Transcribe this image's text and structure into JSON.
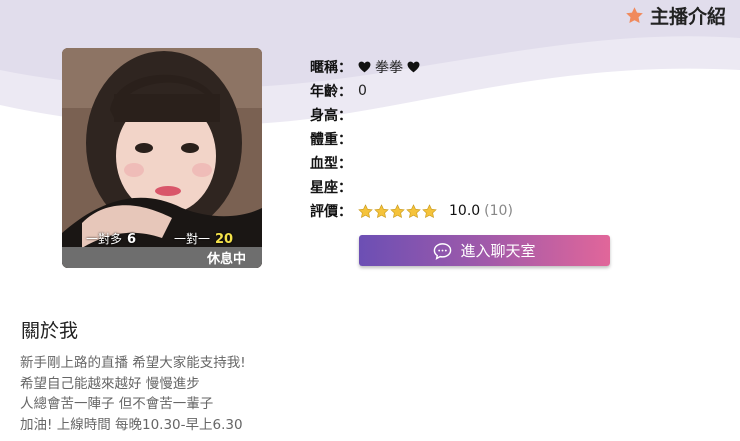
{
  "header": {
    "title": "主播介紹",
    "icon": "star-icon",
    "icon_color": "#f08a5d"
  },
  "profile_card": {
    "stats": [
      {
        "label": "一對多",
        "value": "6"
      },
      {
        "label": "一對一",
        "value": "20"
      }
    ],
    "status": "休息中"
  },
  "info": {
    "nickname": {
      "label": "暱稱：",
      "value": "拳拳"
    },
    "age": {
      "label": "年齡：",
      "value": "0"
    },
    "height": {
      "label": "身高：",
      "value": ""
    },
    "weight": {
      "label": "體重：",
      "value": ""
    },
    "blood_type": {
      "label": "血型：",
      "value": ""
    },
    "zodiac": {
      "label": "星座：",
      "value": ""
    },
    "rating": {
      "label": "評價：",
      "stars": 5,
      "score": "10.0",
      "count": "(10)"
    }
  },
  "chat_button": {
    "label": "進入聊天室",
    "gradient": [
      "#6c4fb4",
      "#e1669a"
    ]
  },
  "about": {
    "title": "關於我",
    "lines": [
      "新手剛上路的直播 希望大家能支持我!",
      "希望自己能越來越好 慢慢進步",
      "人總會苦一陣子 但不會苦一輩子",
      "加油! 上線時間 每晚10.30-早上6.30"
    ]
  }
}
